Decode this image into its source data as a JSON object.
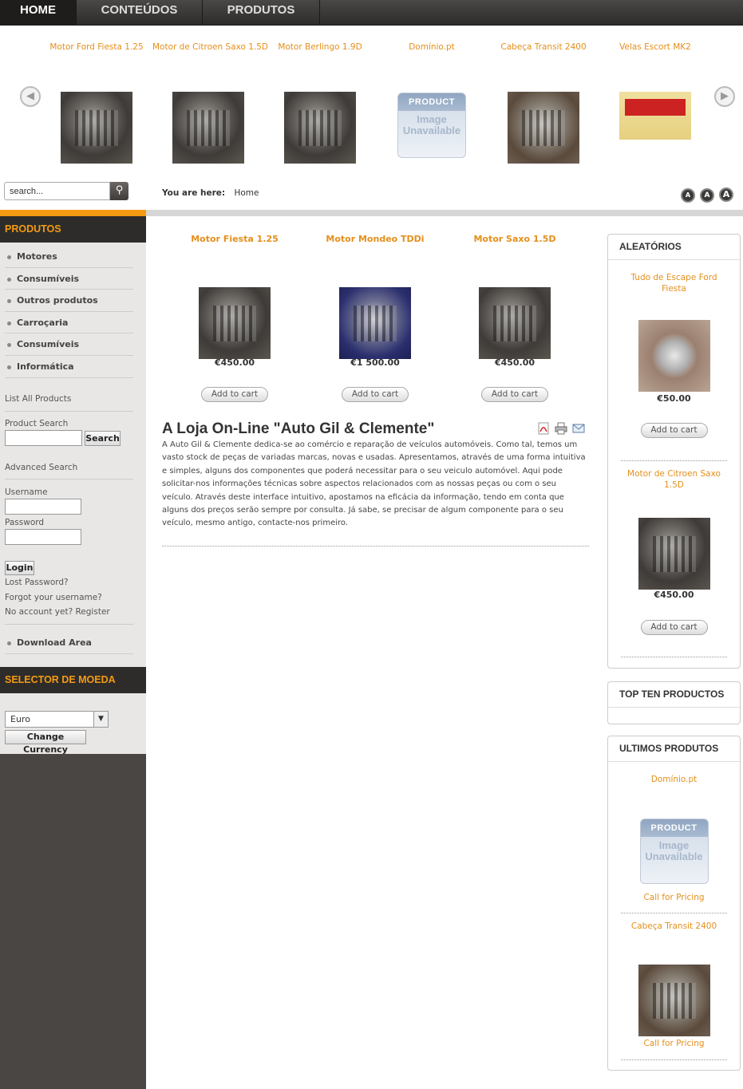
{
  "nav": {
    "tabs": [
      {
        "label": "HOME"
      },
      {
        "label": "CONTEÚDOS"
      },
      {
        "label": "PRODUTOS"
      }
    ]
  },
  "carousel": {
    "prev_icon": "arrow-left-icon",
    "next_icon": "arrow-right-icon",
    "items": [
      {
        "name": "Motor Ford Fiesta 1.25"
      },
      {
        "name": "Motor de Citroen Saxo 1.5D"
      },
      {
        "name": "Motor Berlingo 1.9D"
      },
      {
        "name": "Domínio.pt"
      },
      {
        "name": "Cabeça Transit 2400"
      },
      {
        "name": "Velas Escort MK2"
      }
    ],
    "unavailable": {
      "line1": "PRODUCT",
      "line2": "Image",
      "line3": "Unavailable"
    }
  },
  "search": {
    "placeholder": "search...",
    "icon": "magnifier-icon"
  },
  "breadcrumb": {
    "label": "You are here:",
    "current": "Home"
  },
  "font_sizes": [
    "A",
    "A",
    "A"
  ],
  "sidebar": {
    "produtos_title": "PRODUTOS",
    "menu": [
      {
        "label": "Motores"
      },
      {
        "label": "Consumíveis"
      },
      {
        "label": "Outros produtos"
      },
      {
        "label": "Carroçaria"
      },
      {
        "label": "Consumíveis"
      },
      {
        "label": "Informática"
      }
    ],
    "list_all": "List All Products",
    "product_search_label": "Product Search",
    "search_button": "Search",
    "advanced_search": "Advanced Search",
    "username_label": "Username",
    "password_label": "Password",
    "login_button": "Login",
    "lost_password": "Lost Password?",
    "forgot_username": "Forgot your username?",
    "register": "No account yet? Register",
    "download_area": "Download Area",
    "currency_title": "SELECTOR DE MOEDA",
    "currency_selected": "Euro",
    "change_currency": "Change Currency"
  },
  "featured": [
    {
      "name": "Motor Fiesta 1.25",
      "price": "€450.00",
      "cart": "Add to cart"
    },
    {
      "name": "Motor Mondeo TDDi",
      "price": "€1 500.00",
      "cart": "Add to cart"
    },
    {
      "name": "Motor Saxo 1.5D",
      "price": "€450.00",
      "cart": "Add to cart"
    }
  ],
  "article": {
    "title": "A Loja On-Line \"Auto Gil & Clemente\"",
    "body": "A Auto Gil & Clemente dedica-se ao comércio e reparação de veículos automóveis. Como tal, temos um vasto stock de peças de variadas marcas, novas e usadas. Apresentamos, através de uma forma intuitiva e simples, alguns dos componentes que poderá necessitar para o seu veiculo automóvel. Aqui pode solicitar-nos informações técnicas sobre aspectos relacionados com as nossas peças ou com o seu veículo. Através deste interface intuitivo, apostamos na eficácia da informação, tendo em conta que alguns dos preços serão sempre por consulta. Já sabe, se precisar de algum componente para o seu veículo, mesmo antigo, contacte-nos primeiro.",
    "icons": [
      "pdf-icon",
      "print-icon",
      "email-icon"
    ]
  },
  "aleatorios": {
    "title": "ALEATÓRIOS",
    "items": [
      {
        "name": "Tudo de Escape Ford Fiesta",
        "price": "€50.00",
        "cart": "Add to cart"
      },
      {
        "name": "Motor de Citroen Saxo 1.5D",
        "price": "€450.00",
        "cart": "Add to cart"
      }
    ]
  },
  "top_ten": {
    "title": "TOP TEN PRODUCTOS"
  },
  "ultimos": {
    "title": "ULTIMOS PRODUTOS",
    "items": [
      {
        "name": "Domínio.pt",
        "price": "Call for Pricing"
      },
      {
        "name": "Cabeça Transit 2400",
        "price": "Call for Pricing"
      }
    ]
  },
  "colors": {
    "accent": "#f49b12",
    "link": "#e48f1b",
    "sidebar": "#4a4643",
    "nav": "#2e2c2b"
  }
}
